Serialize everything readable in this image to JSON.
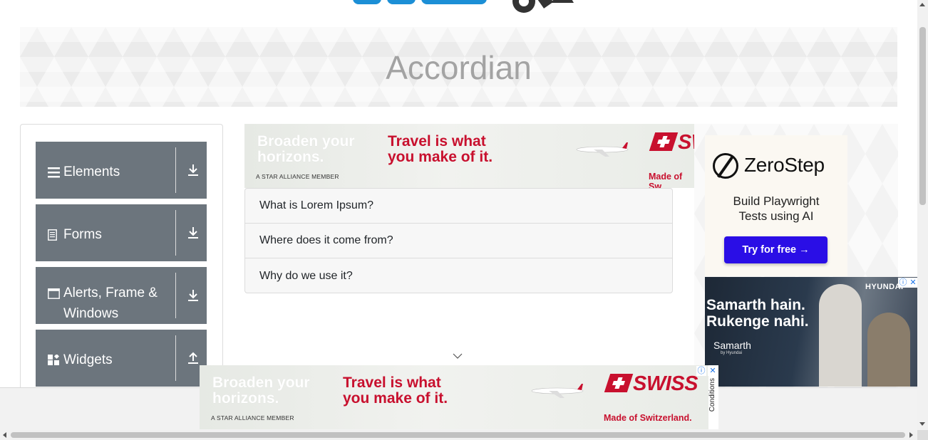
{
  "page": {
    "title": "Accordian"
  },
  "sidebar": {
    "groups": [
      {
        "label": "Elements",
        "icon": "hamburger-icon",
        "arrow": "download-arrow-icon"
      },
      {
        "label": "Forms",
        "icon": "document-icon",
        "arrow": "download-arrow-icon"
      },
      {
        "label": "Alerts, Frame &",
        "label2": "Windows",
        "icon": "window-icon",
        "arrow": "download-arrow-icon"
      },
      {
        "label": "Widgets",
        "icon": "widgets-icon",
        "arrow": "upload-arrow-icon"
      }
    ]
  },
  "accordion": {
    "items": [
      {
        "label": "What is Lorem Ipsum?"
      },
      {
        "label": "Where does it come from?"
      },
      {
        "label": "Why do we use it?"
      }
    ]
  },
  "ads": {
    "swiss": {
      "headline": "Broaden your",
      "headline2": "horizons.",
      "slogan": "Travel is what",
      "slogan2": "you make of it.",
      "member": "A STAR ALLIANCE MEMBER",
      "brand": "SWISS",
      "made": "Made of Switzerland.",
      "brand_partial": "SW",
      "made_partial": "Made of Sw",
      "color": "#c8102e"
    },
    "zerostep": {
      "name": "ZeroStep",
      "tagline": "Build Playwright",
      "tagline2": "Tests using AI",
      "cta": "Try for free →",
      "cta_color": "#2a0ee6"
    },
    "hyundai": {
      "headline": "Samarth hain.",
      "headline2": "Rukenge nahi.",
      "brand": "HYUNDAI",
      "product": "Samarth",
      "by": "by Hyundai"
    },
    "conditions": "Conditions"
  }
}
